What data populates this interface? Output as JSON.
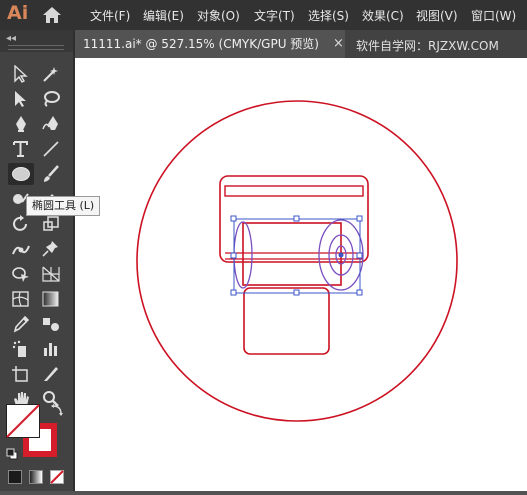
{
  "app": {
    "logo_text": "Ai"
  },
  "menu": [
    "文件(F)",
    "编辑(E)",
    "对象(O)",
    "文字(T)",
    "选择(S)",
    "效果(C)",
    "视图(V)",
    "窗口(W)"
  ],
  "document_tab": {
    "title": "11111.ai* @ 527.15% (CMYK/GPU 预览)",
    "close_glyph": "×"
  },
  "watermark": "软件自学网：RJZXW.COM",
  "toolbar": {
    "collapse_glyph": "◂◂"
  },
  "tooltip": {
    "text": "椭圆工具 (L)"
  },
  "colors": {
    "stroke_red": "#cc1122",
    "selection_blue": "#3b54c8",
    "ellipse_purple": "#7a4fbf"
  }
}
